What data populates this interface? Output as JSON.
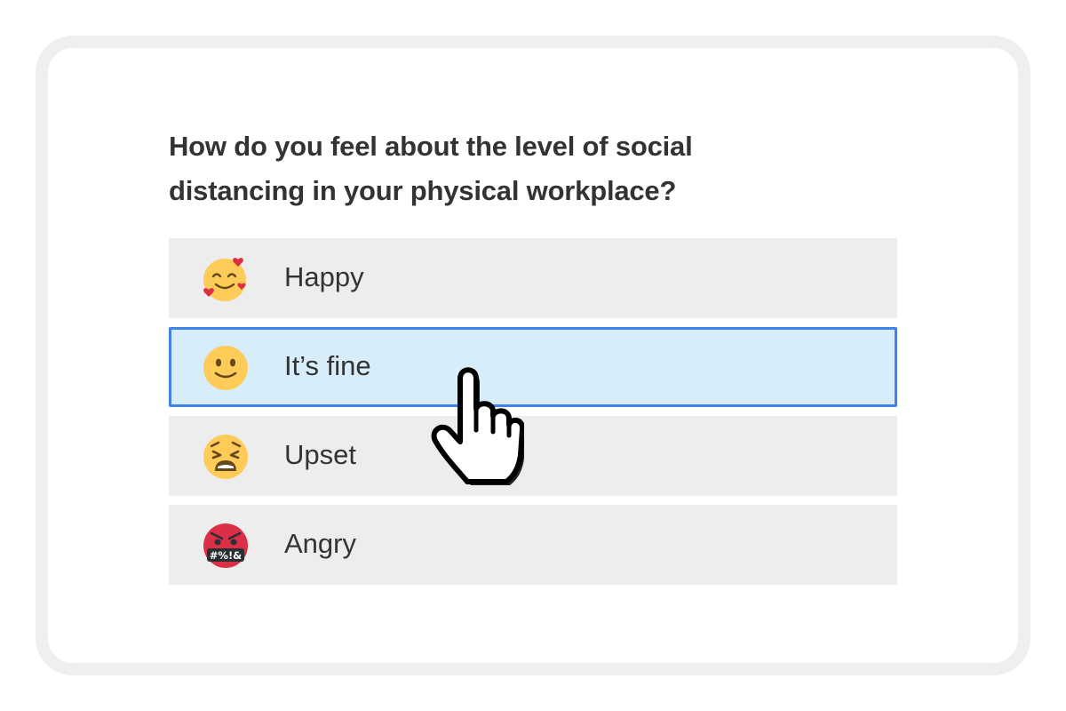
{
  "question": {
    "line1": "How do you feel about the level of social",
    "line2": "distancing in your physical workplace?"
  },
  "options": [
    {
      "label": "Happy",
      "icon": "smiling-face-with-hearts-icon",
      "selected": false
    },
    {
      "label": "It’s fine",
      "icon": "slightly-smiling-face-icon",
      "selected": true
    },
    {
      "label": "Upset",
      "icon": "weary-face-icon",
      "selected": false
    },
    {
      "label": "Angry",
      "icon": "face-with-symbols-on-mouth-icon",
      "selected": false
    }
  ],
  "angry_symbols": "#%!&",
  "colors": {
    "option_bg": "#ededed",
    "selected_bg": "#d8edfa",
    "selected_border": "#3d83e8",
    "emoji_yellow": "#fdcb58",
    "angry_red": "#da2f47"
  }
}
